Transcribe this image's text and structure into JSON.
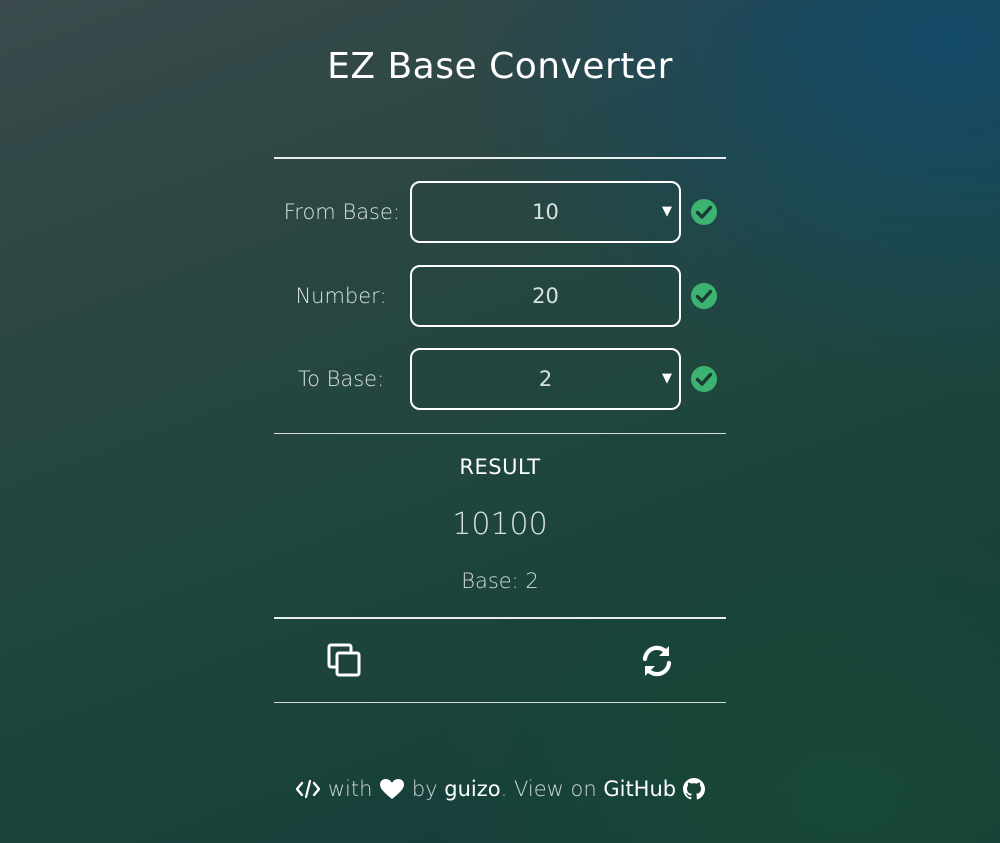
{
  "app": {
    "title": "EZ Base Converter"
  },
  "form": {
    "from_base": {
      "label": "From Base:",
      "value": "10",
      "valid": true
    },
    "number": {
      "label": "Number:",
      "value": "20",
      "valid": true
    },
    "to_base": {
      "label": "To Base:",
      "value": "2",
      "valid": true
    }
  },
  "result": {
    "label": "RESULT",
    "value": "10100",
    "base_text": "Base: 2"
  },
  "actions": {
    "copy_icon": "copy-icon",
    "swap_icon": "refresh-icon"
  },
  "footer": {
    "code_icon": "code-icon",
    "with_text": "with",
    "heart_icon": "heart-icon",
    "by_text": "by",
    "author": "guizo",
    "view_text": ". View on",
    "github_text": "GitHub",
    "github_icon": "github-icon"
  },
  "colors": {
    "check_green": "#3cb371",
    "text": "#ffffff",
    "muted_text": "#d9e2e2"
  }
}
